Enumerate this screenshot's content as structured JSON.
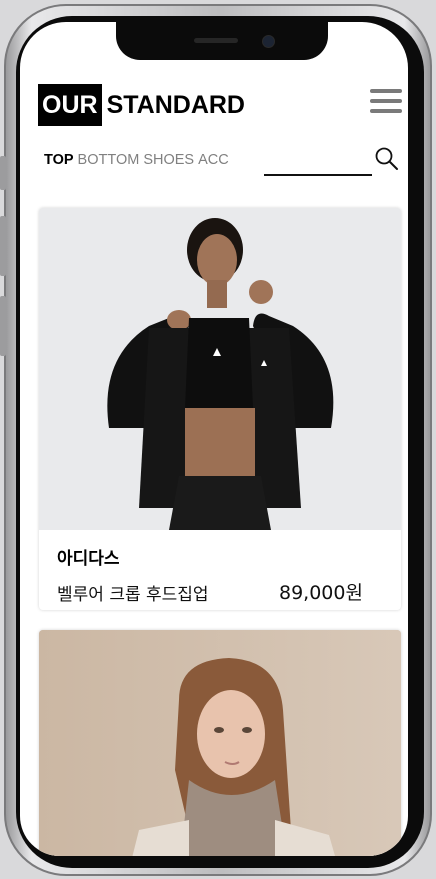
{
  "header": {
    "logo_highlight": "OUR",
    "logo_text": "STANDARD",
    "menu_icon": "hamburger-menu-icon"
  },
  "nav": {
    "tabs": [
      {
        "label": "TOP",
        "active": true
      },
      {
        "label": "BOTTOM",
        "active": false
      },
      {
        "label": "SHOES",
        "active": false
      },
      {
        "label": "ACC",
        "active": false
      }
    ]
  },
  "search": {
    "placeholder": "",
    "icon": "search-icon"
  },
  "products": [
    {
      "brand": "아디다스",
      "name": "벨루어 크롭 후드집업",
      "price": "89,000원"
    },
    {
      "brand": "",
      "name": "",
      "price": ""
    }
  ],
  "colors": {
    "accent": "#000000",
    "muted_tab": "#808080",
    "card_bg": "#ffffff"
  }
}
